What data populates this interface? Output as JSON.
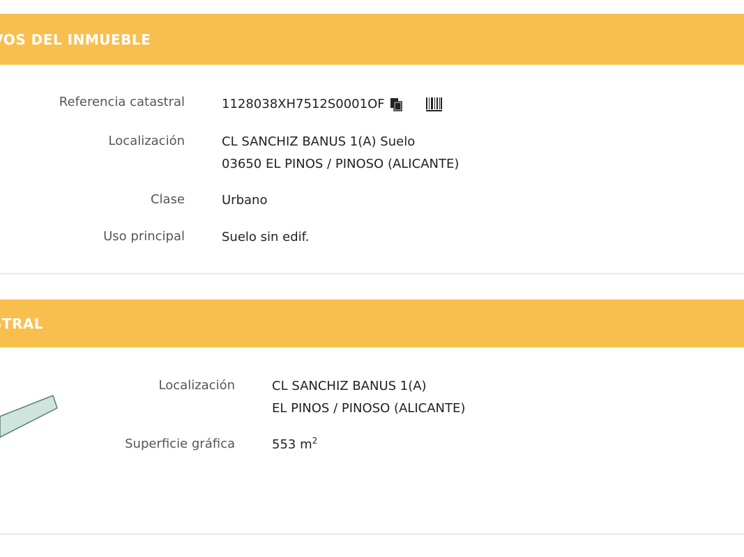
{
  "section1": {
    "title": "IPTIVOS DEL INMUEBLE",
    "rows": {
      "referencia": {
        "label": "Referencia catastral",
        "value": "1128038XH7512S0001OF"
      },
      "localizacion": {
        "label": "Localización",
        "line1": "CL SANCHIZ BANUS 1(A) Suelo",
        "line2": "03650 EL PINOS / PINOSO (ALICANTE)"
      },
      "clase": {
        "label": "Clase",
        "value": "Urbano"
      },
      "uso": {
        "label": "Uso principal",
        "value": "Suelo sin edif."
      }
    }
  },
  "section2": {
    "title": "ASTRAL",
    "rows": {
      "localizacion": {
        "label": "Localización",
        "line1": "CL SANCHIZ BANUS 1(A)",
        "line2": "EL PINOS / PINOSO (ALICANTE)"
      },
      "superficie": {
        "label": "Superficie gráfica",
        "value": "553 m",
        "unit_exp": "2"
      }
    }
  },
  "icons": {
    "copy": "copy-icon",
    "barcode": "barcode-icon"
  },
  "colors": {
    "band": "#f8bf4e",
    "band_text": "#ffffff",
    "parcel_fill": "#cfe4dc",
    "parcel_stroke": "#5a7e70"
  }
}
